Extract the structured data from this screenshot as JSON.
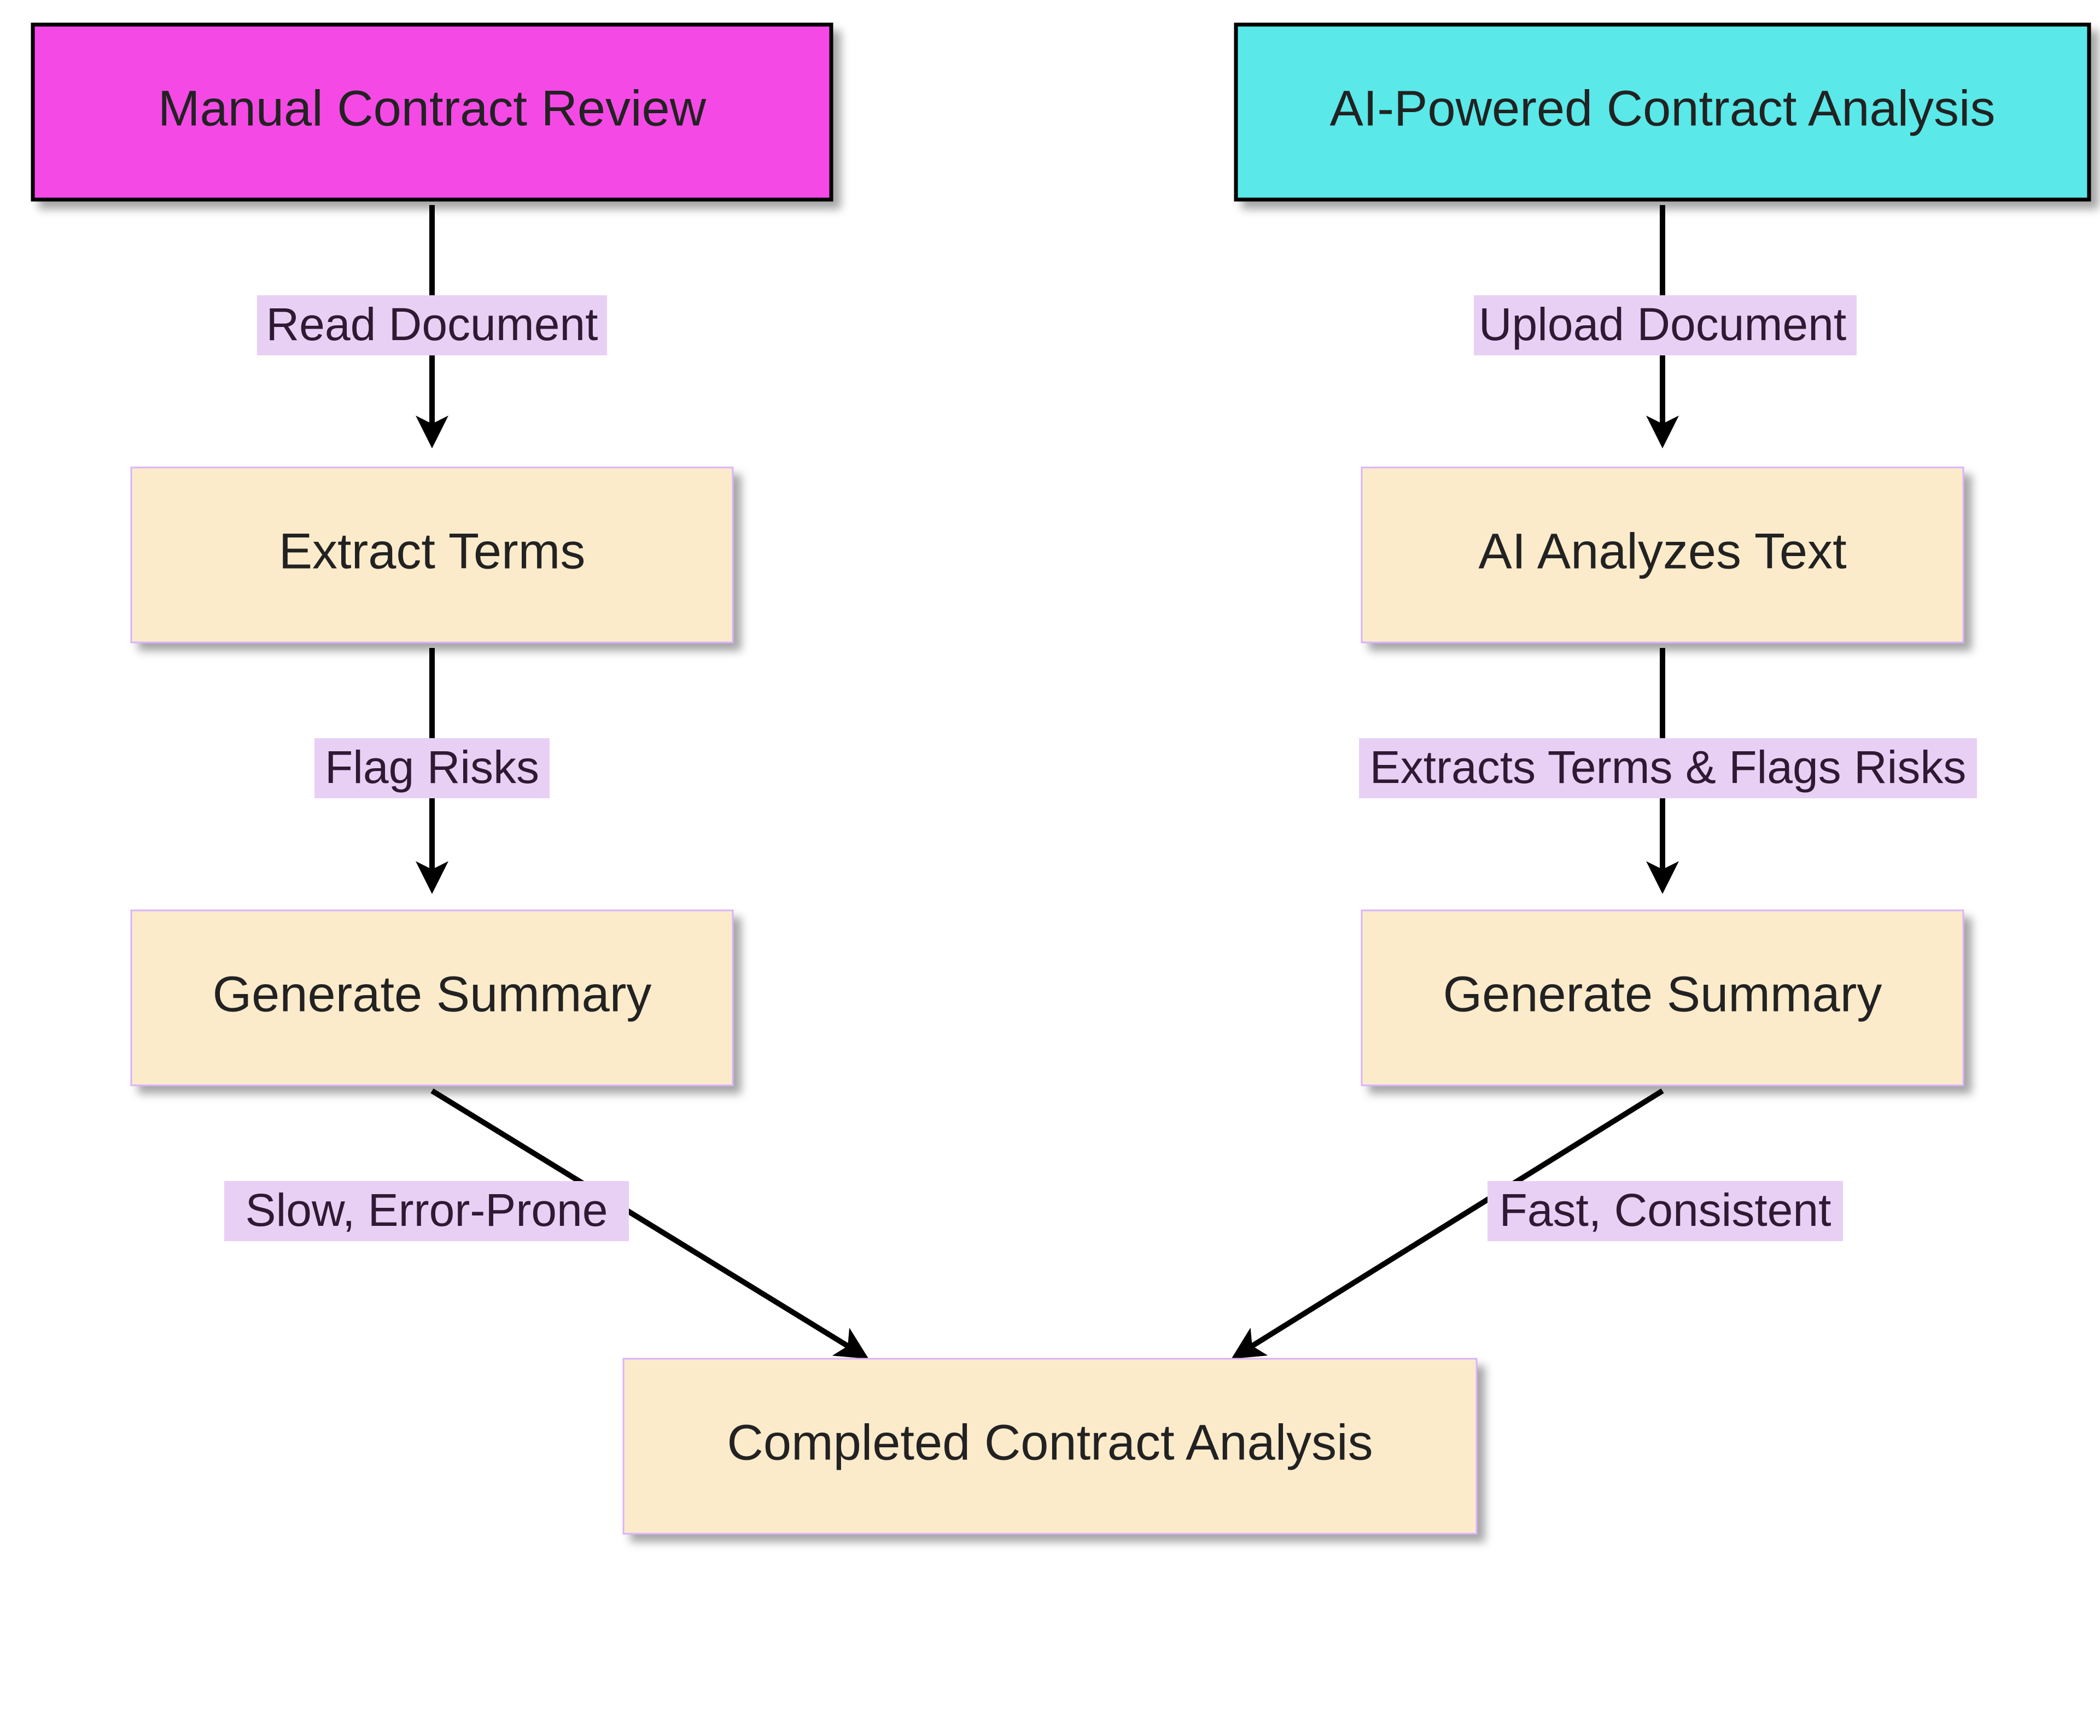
{
  "flowchart": {
    "left": {
      "title": "Manual Contract Review",
      "steps": [
        "Extract Terms",
        "Generate Summary"
      ],
      "edges": [
        "Read Document",
        "Flag Risks",
        "Slow, Error-Prone"
      ]
    },
    "right": {
      "title": "AI-Powered Contract Analysis",
      "steps": [
        "AI Analyzes Text",
        "Generate Summary"
      ],
      "edges": [
        "Upload Document",
        "Extracts Terms & Flags Risks",
        "Fast, Consistent"
      ]
    },
    "end": "Completed Contract Analysis"
  },
  "colors": {
    "manualHeader": "#f54ae6",
    "aiHeader": "#5ae8e8",
    "stepFill": "#fcebcb",
    "labelFill": "#e8d0f5"
  }
}
